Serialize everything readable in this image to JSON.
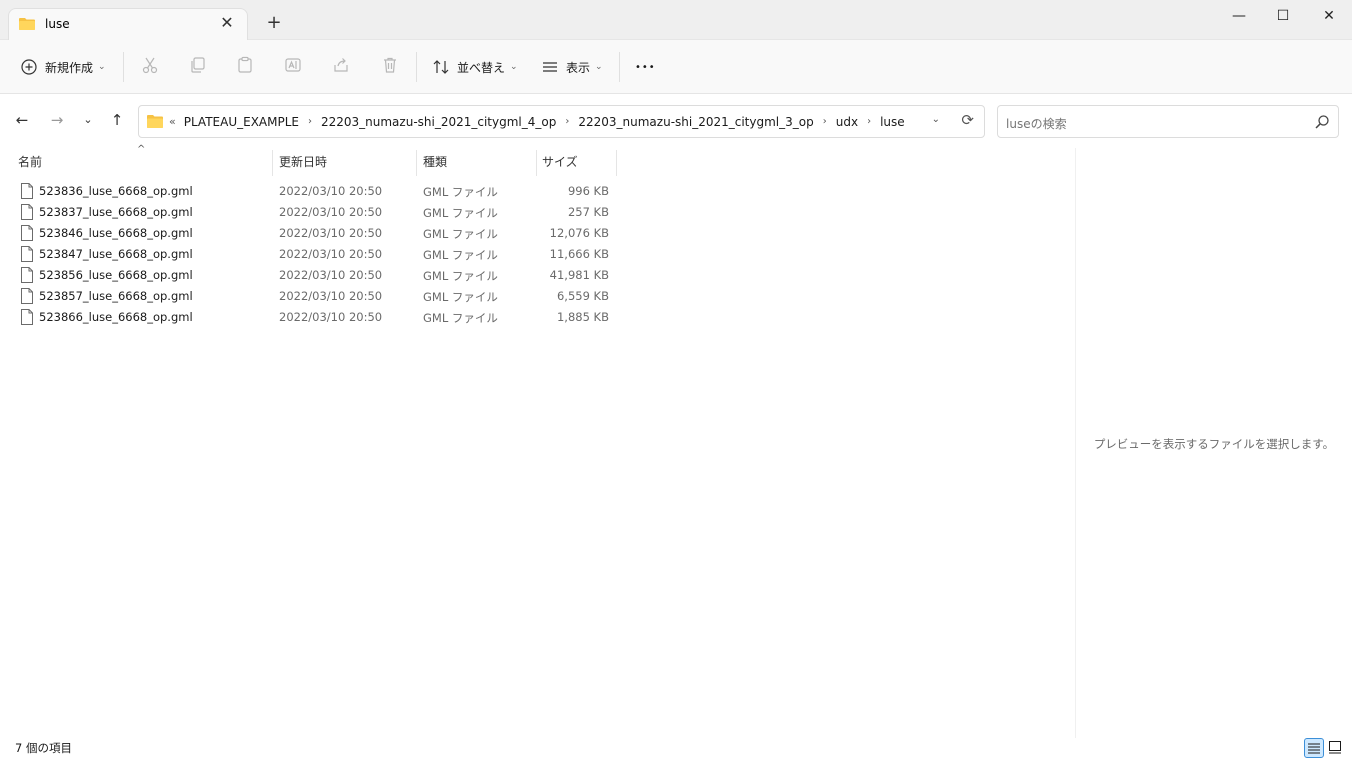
{
  "window": {
    "tab_title": "luse",
    "close_tab_symbol": "✕",
    "new_tab_symbol": "+",
    "minimize_symbol": "—",
    "maximize_symbol": "☐",
    "close_symbol": "✕"
  },
  "toolbar": {
    "new_label": "新規作成",
    "sort_label": "並べ替え",
    "view_label": "表示",
    "more_label": "•••"
  },
  "address": {
    "overflow": "«",
    "crumbs": [
      "PLATEAU_EXAMPLE",
      "22203_numazu-shi_2021_citygml_4_op",
      "22203_numazu-shi_2021_citygml_3_op",
      "udx",
      "luse"
    ],
    "search_placeholder": "luseの検索"
  },
  "columns": {
    "name": "名前",
    "date": "更新日時",
    "type": "種類",
    "size": "サイズ"
  },
  "files": [
    {
      "name": "523836_luse_6668_op.gml",
      "date": "2022/03/10 20:50",
      "type": "GML ファイル",
      "size": "996 KB"
    },
    {
      "name": "523837_luse_6668_op.gml",
      "date": "2022/03/10 20:50",
      "type": "GML ファイル",
      "size": "257 KB"
    },
    {
      "name": "523846_luse_6668_op.gml",
      "date": "2022/03/10 20:50",
      "type": "GML ファイル",
      "size": "12,076 KB"
    },
    {
      "name": "523847_luse_6668_op.gml",
      "date": "2022/03/10 20:50",
      "type": "GML ファイル",
      "size": "11,666 KB"
    },
    {
      "name": "523856_luse_6668_op.gml",
      "date": "2022/03/10 20:50",
      "type": "GML ファイル",
      "size": "41,981 KB"
    },
    {
      "name": "523857_luse_6668_op.gml",
      "date": "2022/03/10 20:50",
      "type": "GML ファイル",
      "size": "6,559 KB"
    },
    {
      "name": "523866_luse_6668_op.gml",
      "date": "2022/03/10 20:50",
      "type": "GML ファイル",
      "size": "1,885 KB"
    }
  ],
  "preview": {
    "message": "プレビューを表示するファイルを選択します。"
  },
  "status": {
    "item_count": "7 個の項目"
  },
  "colors": {
    "folder": "#f6c244",
    "accent": "#3c8fd8"
  }
}
